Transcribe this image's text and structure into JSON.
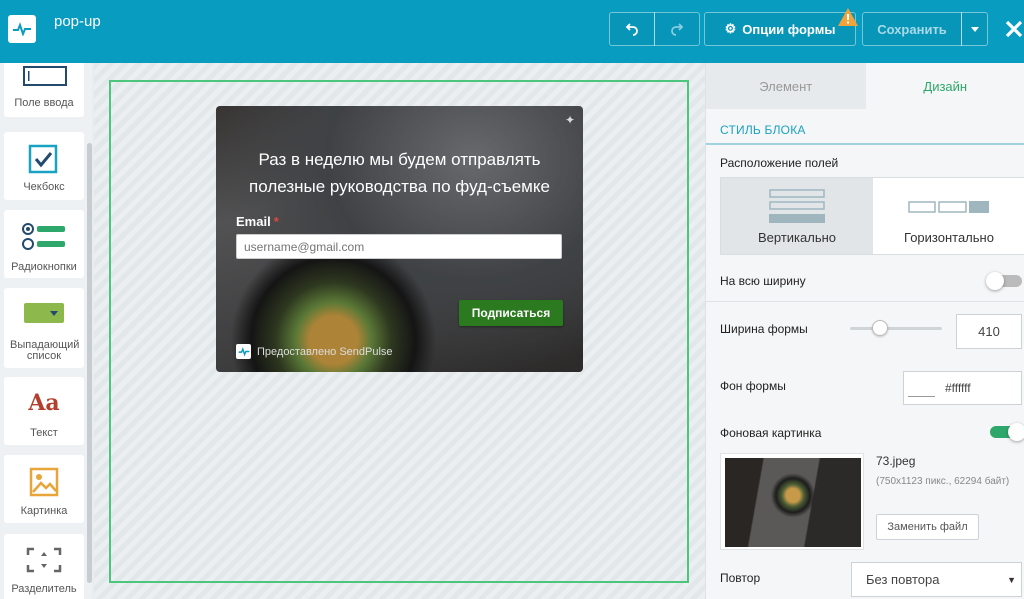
{
  "header": {
    "title": "pop-up",
    "options_label": "Опции формы",
    "save_label": "Сохранить"
  },
  "palette": {
    "items": [
      {
        "label": "Поле ввода",
        "icon": "input-field-icon"
      },
      {
        "label": "Чекбокс",
        "icon": "checkbox-icon"
      },
      {
        "label": "Радиокнопки",
        "icon": "radio-buttons-icon"
      },
      {
        "label": "Выпадающий список",
        "icon": "dropdown-icon"
      },
      {
        "label": "Текст",
        "icon_text": "Aa"
      },
      {
        "label": "Картинка",
        "icon": "image-icon"
      },
      {
        "label": "Разделитель",
        "icon": "divider-icon"
      }
    ]
  },
  "form_preview": {
    "heading": "Раз в неделю мы будем отправлять полезные руководства по фуд-съемке",
    "email_label": "Email",
    "required_mark": "*",
    "email_placeholder": "username@gmail.com",
    "subscribe_label": "Подписаться",
    "powered_by": "Предоставлено SendPulse"
  },
  "panel": {
    "tabs": [
      {
        "label": "Элемент",
        "active": false
      },
      {
        "label": "Дизайн",
        "active": true
      }
    ],
    "section_title": "СТИЛЬ БЛОКА",
    "field_layout": {
      "label": "Расположение полей",
      "options": [
        "Вертикально",
        "Горизонтально"
      ],
      "selected": "Вертикально"
    },
    "full_width": {
      "label": "На всю ширину",
      "enabled": false
    },
    "form_width": {
      "label": "Ширина формы",
      "value": "410"
    },
    "form_bg": {
      "label": "Фон формы",
      "value": "#ffffff"
    },
    "bg_image": {
      "label": "Фоновая картинка",
      "enabled": true,
      "file_name": "73.jpeg",
      "file_meta": "(750x1123 пикс., 62294 байт)",
      "replace_label": "Заменить файл"
    },
    "repeat": {
      "label": "Повтор",
      "value": "Без повтора"
    }
  },
  "colors": {
    "topbar": "#089cc0",
    "accent_green": "#2ea86a",
    "subscribe_button": "#2c7a1f",
    "dropzone_border": "#4cc67c",
    "warning": "#f0a33a"
  }
}
